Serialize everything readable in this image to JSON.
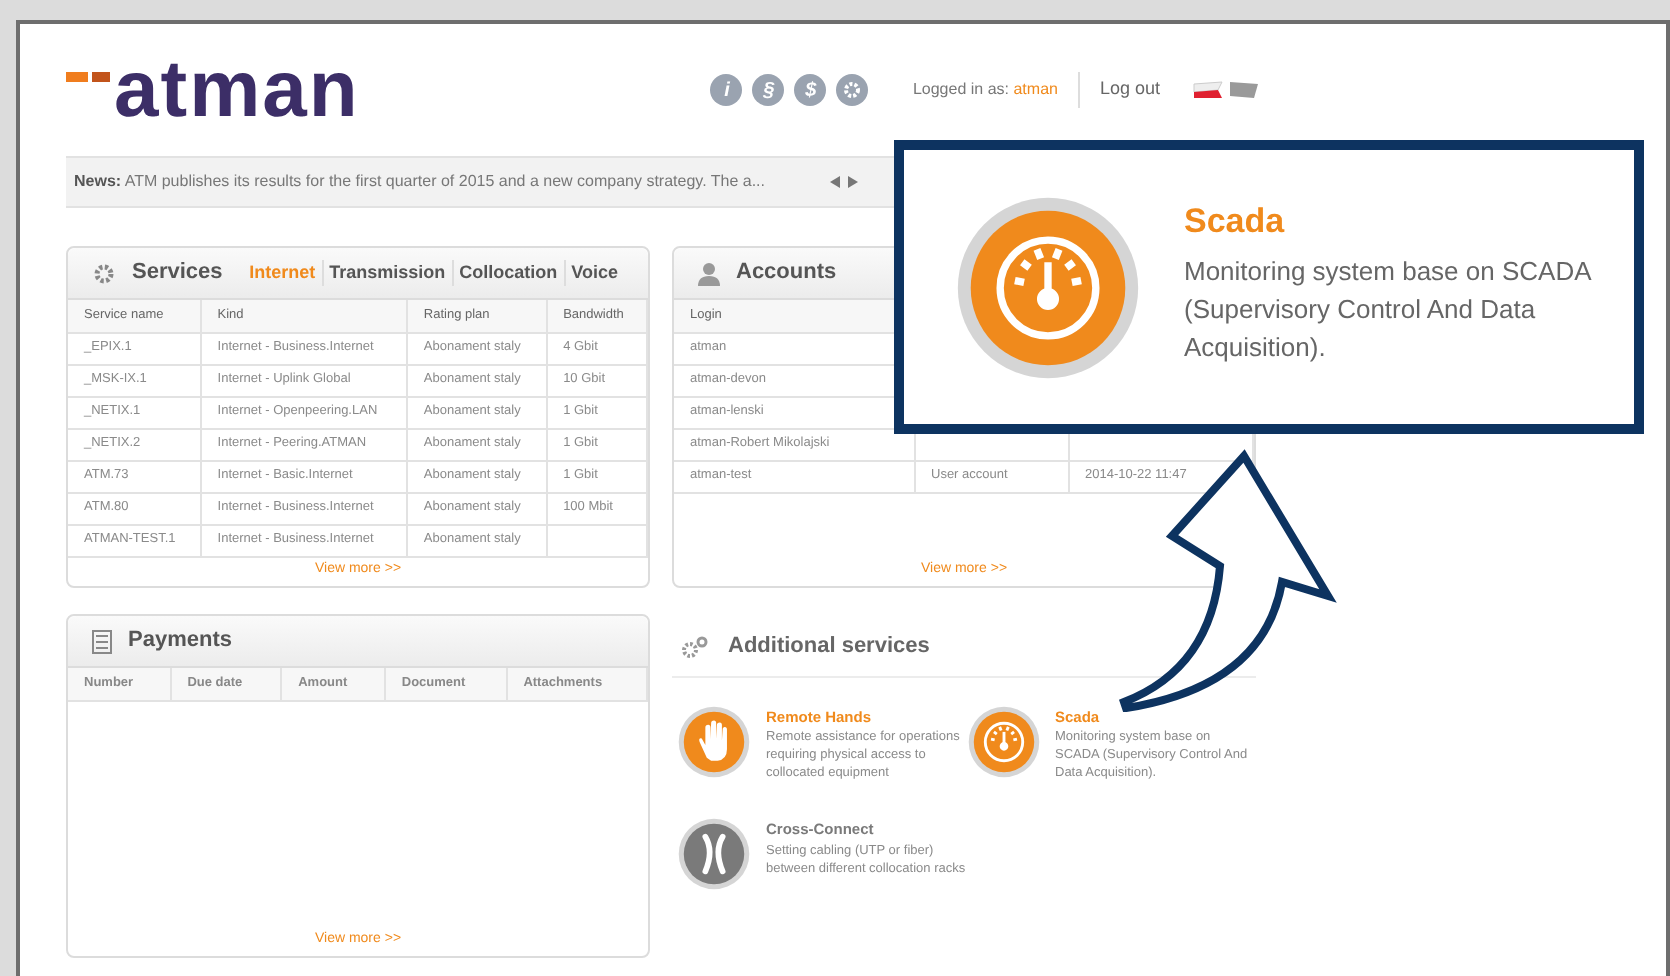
{
  "header": {
    "logo": "atman",
    "icons": [
      "i",
      "§",
      "$"
    ],
    "logged_in_label": "Logged in as:",
    "user": "atman",
    "logout": "Log out"
  },
  "news": {
    "label": "News:",
    "text": "ATM publishes its results for the first quarter of 2015 and a new company strategy. The a..."
  },
  "services": {
    "title": "Services",
    "tabs": [
      {
        "label": "Internet",
        "selected": true
      },
      {
        "label": "Transmission",
        "selected": false
      },
      {
        "label": "Collocation",
        "selected": false
      },
      {
        "label": "Voice",
        "selected": false
      }
    ],
    "columns": [
      "Service name",
      "Kind",
      "Rating plan",
      "Bandwidth"
    ],
    "rows": [
      [
        "_EPIX.1",
        "Internet - Business.Internet",
        "Abonament staly",
        "4 Gbit"
      ],
      [
        "_MSK-IX.1",
        "Internet - Uplink Global",
        "Abonament staly",
        "10 Gbit"
      ],
      [
        "_NETIX.1",
        "Internet - Openpeering.LAN",
        "Abonament staly",
        "1 Gbit"
      ],
      [
        "_NETIX.2",
        "Internet - Peering.ATMAN",
        "Abonament staly",
        "1 Gbit"
      ],
      [
        "ATM.73",
        "Internet - Basic.Internet",
        "Abonament staly",
        "1 Gbit"
      ],
      [
        "ATM.80",
        "Internet - Business.Internet",
        "Abonament staly",
        "100 Mbit"
      ],
      [
        "ATMAN-TEST.1",
        "Internet - Business.Internet",
        "Abonament staly",
        ""
      ]
    ],
    "view_more": "View more >>"
  },
  "accounts": {
    "title": "Accounts",
    "columns": [
      "Login"
    ],
    "rows": [
      {
        "login": "atman"
      },
      {
        "login": "atman-devon"
      },
      {
        "login": "atman-lenski"
      },
      {
        "login": "atman-Robert Mikolajski"
      },
      {
        "login": "atman-test",
        "column_2": "User account",
        "column_3": "2014-10-22 11:47"
      }
    ],
    "view_more": "View more >>"
  },
  "payments": {
    "title": "Payments",
    "columns": [
      "Number",
      "Due date",
      "Amount",
      "Document",
      "Attachments"
    ],
    "view_more": "View more >>"
  },
  "additional_services": {
    "title": "Additional services",
    "items": [
      {
        "kind": "hand",
        "title": "Remote Hands",
        "description": "Remote assistance for operations requiring physical access to collocated equipment",
        "color": "#f08a1c"
      },
      {
        "kind": "gauge",
        "title": "Scada",
        "description": "Monitoring system base on SCADA (Supervisory Control And Data Acquisition).",
        "color": "#f08a1c"
      },
      {
        "kind": "cross",
        "title": "Cross-Connect",
        "description": "Setting cabling (UTP or fiber) between different collocation racks",
        "color": "#7a7a7a"
      }
    ]
  },
  "callout": {
    "title": "Scada",
    "description": "Monitoring system base on SCADA (Supervisory Control And Data Acquisition)."
  }
}
